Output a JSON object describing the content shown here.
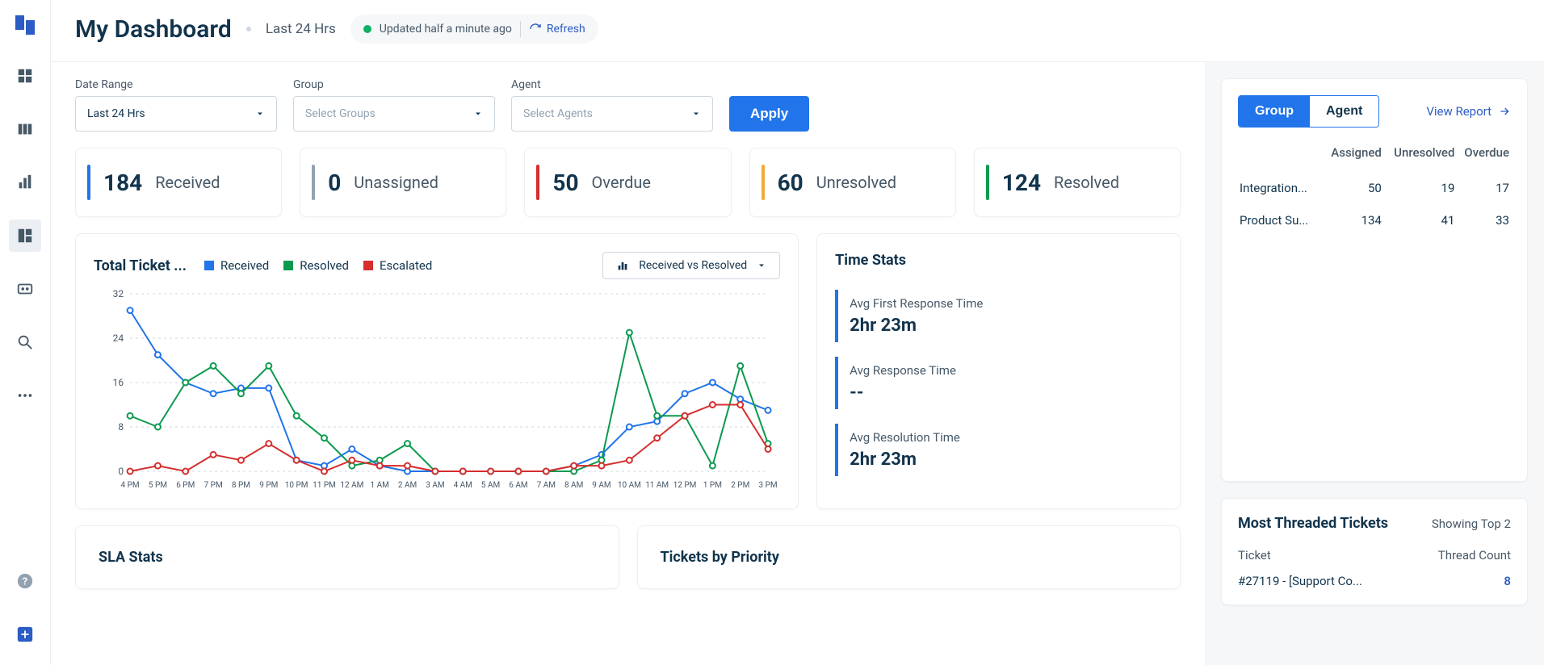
{
  "header": {
    "title": "My Dashboard",
    "subtitle": "Last 24 Hrs",
    "updated_text": "Updated half a minute ago",
    "refresh_label": "Refresh"
  },
  "filters": {
    "date_range_label": "Date Range",
    "date_range_value": "Last 24 Hrs",
    "group_label": "Group",
    "group_placeholder": "Select Groups",
    "agent_label": "Agent",
    "agent_placeholder": "Select Agents",
    "apply_label": "Apply"
  },
  "stat_cards": [
    {
      "value": "184",
      "label": "Received",
      "color": "#2174e9"
    },
    {
      "value": "0",
      "label": "Unassigned",
      "color": "#92a2b1"
    },
    {
      "value": "50",
      "label": "Overdue",
      "color": "#d62d2d"
    },
    {
      "value": "60",
      "label": "Unresolved",
      "color": "#f2a93b"
    },
    {
      "value": "124",
      "label": "Resolved",
      "color": "#0d9a4f"
    }
  ],
  "chart_panel": {
    "title": "Total Ticket ...",
    "legend": [
      {
        "label": "Received",
        "color": "#2174e9"
      },
      {
        "label": "Resolved",
        "color": "#0d9a4f"
      },
      {
        "label": "Escalated",
        "color": "#d62d2d"
      }
    ],
    "selector": "Received vs Resolved"
  },
  "chart_data": {
    "type": "line",
    "categories": [
      "4 PM",
      "5 PM",
      "6 PM",
      "7 PM",
      "8 PM",
      "9 PM",
      "10 PM",
      "11 PM",
      "12 AM",
      "1 AM",
      "2 AM",
      "3 AM",
      "4 AM",
      "5 AM",
      "6 AM",
      "7 AM",
      "8 AM",
      "9 AM",
      "10 AM",
      "11 AM",
      "12 PM",
      "1 PM",
      "2 PM",
      "3 PM"
    ],
    "series": [
      {
        "name": "Received",
        "color": "#2174e9",
        "values": [
          29,
          21,
          16,
          14,
          15,
          15,
          2,
          1,
          4,
          1,
          0,
          0,
          0,
          0,
          0,
          0,
          1,
          3,
          8,
          9,
          14,
          16,
          13,
          11
        ]
      },
      {
        "name": "Resolved",
        "color": "#0d9a4f",
        "values": [
          10,
          8,
          16,
          19,
          14,
          19,
          10,
          6,
          1,
          2,
          5,
          0,
          0,
          0,
          0,
          0,
          0,
          2,
          25,
          10,
          10,
          1,
          19,
          5
        ]
      },
      {
        "name": "Escalated",
        "color": "#d62d2d",
        "values": [
          0,
          1,
          0,
          3,
          2,
          5,
          2,
          0,
          2,
          1,
          1,
          0,
          0,
          0,
          0,
          0,
          1,
          1,
          2,
          6,
          10,
          12,
          12,
          4
        ]
      }
    ],
    "ylim": [
      0,
      32
    ],
    "yticks": [
      0,
      8,
      16,
      24,
      32
    ],
    "title": "Total Ticket Trend",
    "xlabel": "",
    "ylabel": ""
  },
  "time_stats": {
    "title": "Time Stats",
    "metrics": [
      {
        "label": "Avg First Response Time",
        "value": "2hr 23m"
      },
      {
        "label": "Avg Response Time",
        "value": "--"
      },
      {
        "label": "Avg Resolution Time",
        "value": "2hr 23m"
      }
    ]
  },
  "bottom_panels": {
    "sla_title": "SLA Stats",
    "priority_title": "Tickets by Priority"
  },
  "right": {
    "seg_group": "Group",
    "seg_agent": "Agent",
    "view_report": "View Report",
    "table": {
      "headers": [
        "",
        "Assigned",
        "Unresolved",
        "Overdue"
      ],
      "rows": [
        {
          "name": "Integration...",
          "assigned": "50",
          "unresolved": "19",
          "overdue": "17"
        },
        {
          "name": "Product Su...",
          "assigned": "134",
          "unresolved": "41",
          "overdue": "33"
        }
      ]
    },
    "threaded": {
      "title": "Most Threaded Tickets",
      "showing": "Showing Top 2",
      "col_ticket": "Ticket",
      "col_count": "Thread Count",
      "rows": [
        {
          "name": "#27119 - [Support Co...",
          "count": "8"
        }
      ]
    }
  }
}
